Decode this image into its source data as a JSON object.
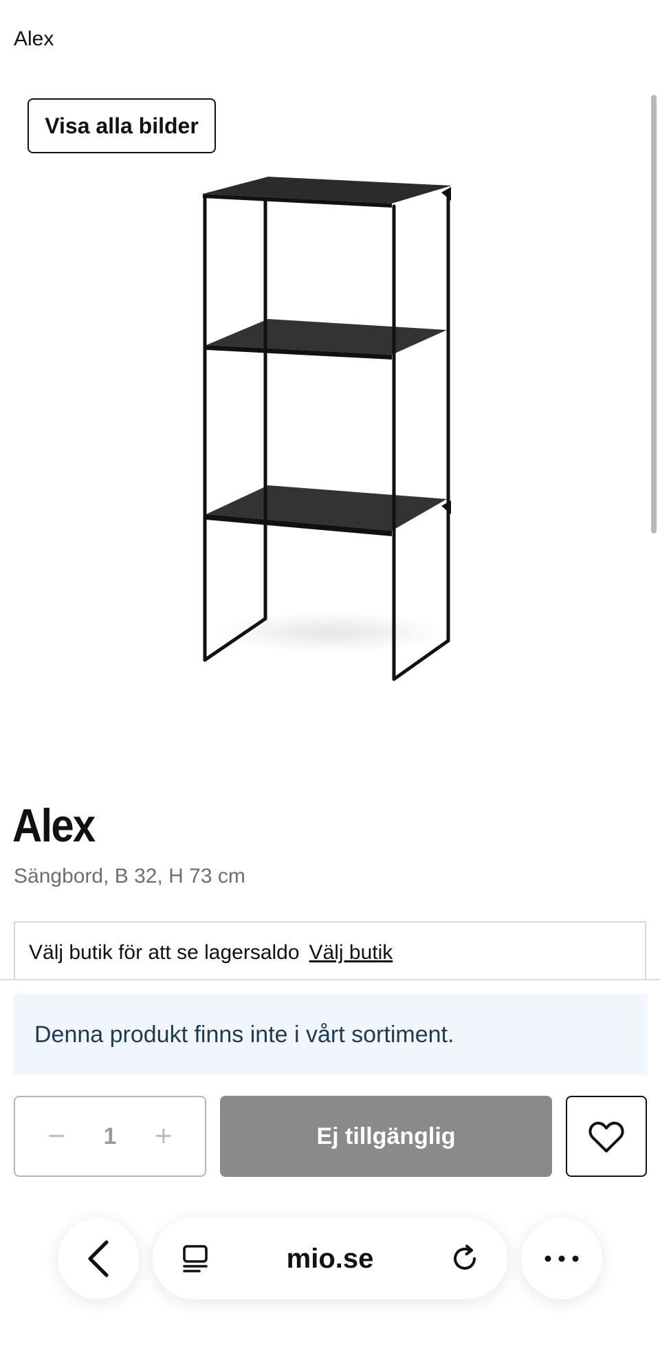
{
  "breadcrumb": "Alex",
  "gallery": {
    "view_all_label": "Visa alla bilder"
  },
  "product": {
    "title": "Alex",
    "subtitle": "Sängbord, B 32, H 73 cm"
  },
  "store": {
    "prompt": "Välj butik för att se lagersaldo",
    "link_label": "Välj butik"
  },
  "notice": "Denna produkt finns inte i vårt sortiment.",
  "quantity": {
    "minus": "−",
    "value": "1",
    "plus": "+"
  },
  "add_button_label": "Ej tillgänglig",
  "browser": {
    "url": "mio.se"
  },
  "icons": {
    "favorite": "heart-icon",
    "back": "chevron-left-icon",
    "tabs": "tabs-icon",
    "reload": "reload-icon",
    "more": "more-dots-icon"
  },
  "colors": {
    "notice_bg": "#f0f6fb",
    "notice_text": "#1f3b53",
    "disabled_button": "#8a8a8a"
  }
}
